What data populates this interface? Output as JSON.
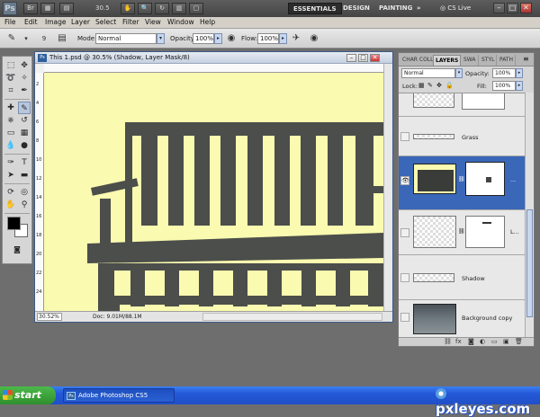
{
  "app": {
    "logo": "Ps",
    "zoom_value": "30.5",
    "workspaces": [
      "ESSENTIALS",
      "DESIGN",
      "PAINTING"
    ],
    "workspace_more": "»",
    "cs_live": "CS Live",
    "window_buttons": [
      "–",
      "□",
      "✕"
    ]
  },
  "menu": [
    "File",
    "Edit",
    "Image",
    "Layer",
    "Select",
    "Filter",
    "View",
    "Window",
    "Help"
  ],
  "options": {
    "brush_size": "9",
    "mode_label": "Mode:",
    "mode_value": "Normal",
    "opacity_label": "Opacity:",
    "opacity_value": "100%",
    "flow_label": "Flow:",
    "flow_value": "100%"
  },
  "document": {
    "title": "This 1.psd @ 30.5% (Shadow, Layer Mask/8)",
    "zoom": "30.52%",
    "info": "Doc: 9.01M/88.1M",
    "ruler_left_ticks": [
      "2",
      "4",
      "6",
      "8",
      "10",
      "12",
      "14",
      "16",
      "18",
      "20",
      "22",
      "24"
    ],
    "background_color": "#fafab0",
    "bench_color": "#4b4e4a"
  },
  "panel": {
    "tabs": [
      "CHAR COLL",
      "LAYERS",
      "SWA",
      "STYL",
      "PATH"
    ],
    "blend_mode": "Normal",
    "opacity_label": "Opacity:",
    "opacity_value": "100%",
    "lock_label": "Lock:",
    "fill_label": "Fill:",
    "fill_value": "100%",
    "layers": [
      {
        "name": "",
        "selected": false,
        "visible": false
      },
      {
        "name": "Grass",
        "selected": false,
        "visible": false
      },
      {
        "name": "...",
        "selected": true,
        "visible": true
      },
      {
        "name": "L...",
        "selected": false,
        "visible": false
      },
      {
        "name": "Shadow",
        "selected": false,
        "visible": false
      },
      {
        "name": "Background copy",
        "selected": false,
        "visible": false
      }
    ],
    "bottom_icons": [
      "link-icon",
      "fx-icon",
      "mask-icon",
      "adjustment-icon",
      "folder-icon",
      "new-layer-icon",
      "trash-icon"
    ]
  },
  "taskbar": {
    "start": "start",
    "task_app": "Adobe Photoshop CS5",
    "watermark": "pxleyes.com"
  },
  "colors": {
    "selected_layer": "#3a67b8",
    "taskbar": "#2458d8",
    "start_green": "#3ea63c"
  }
}
